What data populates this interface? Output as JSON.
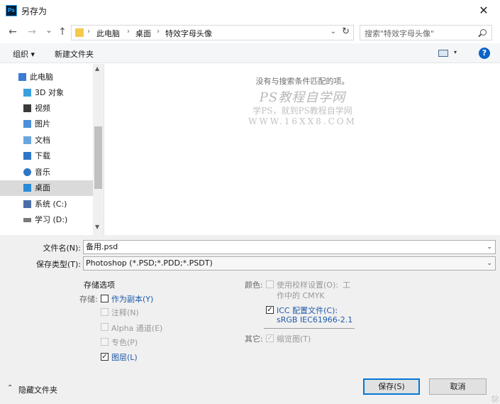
{
  "window": {
    "title": "另存为",
    "app_icon_text": "Ps",
    "close_glyph": "✕"
  },
  "nav": {
    "back_glyph": "←",
    "forward_glyph": "→",
    "recent_glyph": "⌄",
    "up_glyph": "↑",
    "breadcrumb": [
      "此电脑",
      "桌面",
      "特效字母头像"
    ],
    "separator_glyph": "›",
    "dropdown_glyph": "⌄",
    "refresh_glyph": "↻",
    "search_placeholder": "搜索\"特效字母头像\""
  },
  "toolbar": {
    "organize_label": "组织 ▾",
    "new_folder_label": "新建文件夹",
    "view_dropdown_glyph": "▾",
    "help_label": "?"
  },
  "sidebar": {
    "items": [
      {
        "label": "此电脑",
        "icon": "computer-icon",
        "color": "#3b7bd4"
      },
      {
        "label": "3D 对象",
        "icon": "3d-objects-icon",
        "color": "#3aa0e0"
      },
      {
        "label": "视频",
        "icon": "video-icon",
        "color": "#3a3a3a"
      },
      {
        "label": "图片",
        "icon": "pictures-icon",
        "color": "#4a8fd8"
      },
      {
        "label": "文档",
        "icon": "documents-icon",
        "color": "#6aa6dd"
      },
      {
        "label": "下载",
        "icon": "downloads-icon",
        "color": "#2f76c7"
      },
      {
        "label": "音乐",
        "icon": "music-icon",
        "color": "#2f76c7"
      },
      {
        "label": "桌面",
        "icon": "desktop-icon",
        "color": "#2a8ad8"
      },
      {
        "label": "系统 (C:)",
        "icon": "drive-c-icon",
        "color": "#4a6fa8"
      },
      {
        "label": "学习 (D:)",
        "icon": "drive-d-icon",
        "color": "#7a7a7a"
      }
    ],
    "selected": "桌面",
    "scroll_up_glyph": "▲",
    "scroll_down_glyph": "▼"
  },
  "content": {
    "empty_message": "没有与搜索条件匹配的项。",
    "watermark_title": "PS教程自学网",
    "watermark_sub": "学PS，就到PS教程自学网",
    "watermark_url": "WWW.16XX8.COM"
  },
  "form": {
    "filename_label": "文件名(N):",
    "filename_value": "备用.psd",
    "filetype_label": "保存类型(T):",
    "filetype_value": "Photoshop (*.PSD;*.PDD;*.PSDT)",
    "dropdown_glyph": "⌄"
  },
  "options": {
    "section_title": "存储选项",
    "save_label": "存储:",
    "as_copy": {
      "label": "作为副本(Y)",
      "checked": false
    },
    "notes": {
      "label": "注释(N)",
      "checked": false
    },
    "alpha": {
      "label": "Alpha 通道(E)",
      "checked": false
    },
    "spot": {
      "label": "专色(P)",
      "checked": false
    },
    "layers": {
      "label": "图层(L)",
      "checked": true
    },
    "color_label": "颜色:",
    "proof_line1": "使用校样设置(O):",
    "proof_suffix": "工",
    "proof_line2": "作中的 CMYK",
    "icc_line1": "ICC 配置文件(C):",
    "icc_line2": "sRGB IEC61966-2.1",
    "icc_checked": true,
    "other_label": "其它:",
    "thumbnail": {
      "label": "缩览图(T)",
      "checked": true
    },
    "check_glyph": "✓"
  },
  "footer": {
    "hide_folders_label": "隐藏文件夹",
    "hide_folders_glyph": "⌃",
    "save_button": "保存(S)",
    "cancel_button": "取消"
  }
}
